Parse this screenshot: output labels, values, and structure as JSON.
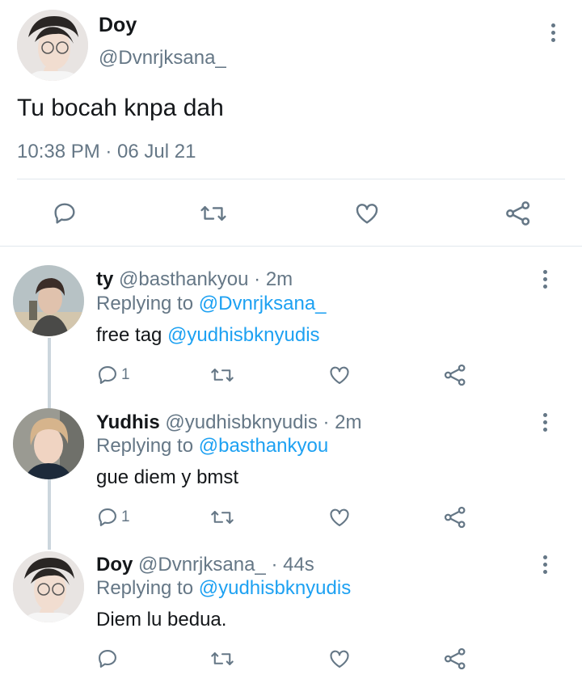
{
  "main_tweet": {
    "display_name": "Doy",
    "handle": "@Dvnrjksana_",
    "text": "Tu bocah knpa dah",
    "timestamp": "10:38 PM · 06 Jul 21"
  },
  "replies": [
    {
      "display_name": "ty",
      "handle": "@basthankyou",
      "age": "· 2m",
      "replying_prefix": "Replying to",
      "replying_to": "@Dvnrjksana_",
      "text_prefix": "free tag",
      "text_mention": "@yudhisbknyudis",
      "reply_count": "1"
    },
    {
      "display_name": "Yudhis",
      "handle": "@yudhisbknyudis",
      "age": "· 2m",
      "replying_prefix": "Replying to",
      "replying_to": "@basthankyou",
      "text": "gue diem y bmst",
      "reply_count": "1"
    },
    {
      "display_name": "Doy",
      "handle": "@Dvnrjksana_",
      "age": "· 44s",
      "replying_prefix": "Replying to",
      "replying_to": "@yudhisbknyudis",
      "text": "Diem lu bedua.",
      "reply_count": ""
    }
  ],
  "colors": {
    "link": "#1da1f2",
    "secondary_text": "#657786",
    "divider": "#e1e8ed",
    "thread_line": "#ccd6dd"
  },
  "icons": [
    "more-vertical-icon",
    "reply-icon",
    "retweet-icon",
    "like-icon",
    "share-icon"
  ]
}
